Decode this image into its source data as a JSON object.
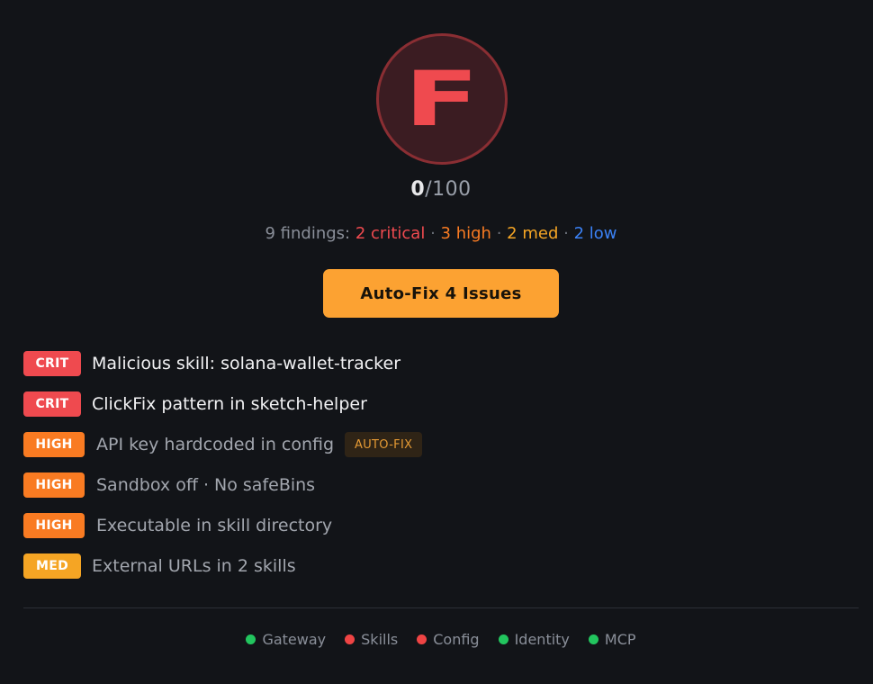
{
  "grade": {
    "letter": "F",
    "ring_color": "#8a2e33",
    "fill_color": "#3b1c22",
    "letter_color": "#ef4a4f"
  },
  "score": {
    "value": "0",
    "max_text": "/100"
  },
  "findings": {
    "total_text": "9 findings:",
    "critical_text": "2 critical",
    "high_text": "3 high",
    "med_text": "2 med",
    "low_text": "2 low",
    "separator": "·"
  },
  "autofix_button": {
    "label": "Auto-Fix 4 Issues",
    "color": "#fca232"
  },
  "issues": [
    {
      "severity": "CRIT",
      "text": "Malicious skill: solana-wallet-tracker",
      "autofix": ""
    },
    {
      "severity": "CRIT",
      "text": "ClickFix pattern in sketch-helper",
      "autofix": ""
    },
    {
      "severity": "HIGH",
      "text": "API key hardcoded in config",
      "autofix": "AUTO-FIX"
    },
    {
      "severity": "HIGH",
      "text": "Sandbox off · No safeBins",
      "autofix": ""
    },
    {
      "severity": "HIGH",
      "text": "Executable in skill directory",
      "autofix": ""
    },
    {
      "severity": "MED",
      "text": "External URLs in 2 skills",
      "autofix": ""
    }
  ],
  "status": [
    {
      "label": "Gateway",
      "color": "#22c55e"
    },
    {
      "label": "Skills",
      "color": "#ef4444"
    },
    {
      "label": "Config",
      "color": "#ef4444"
    },
    {
      "label": "Identity",
      "color": "#22c55e"
    },
    {
      "label": "MCP",
      "color": "#22c55e"
    }
  ],
  "colors": {
    "background": "#121418",
    "critical": "#ef4a4f",
    "high": "#f97b22",
    "med": "#f5a524",
    "low": "#3b82f6"
  }
}
